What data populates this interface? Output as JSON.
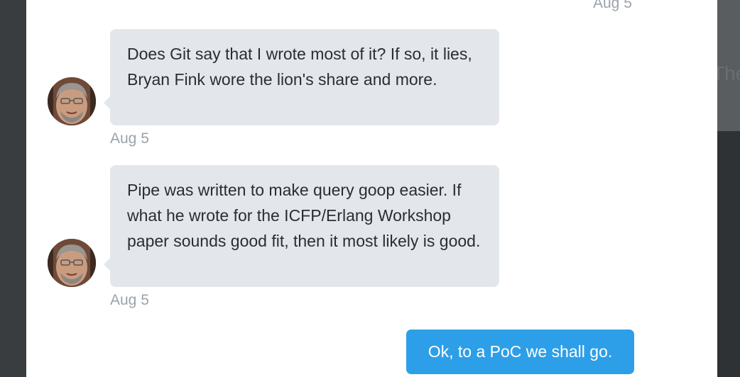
{
  "background": {
    "peek_text": "The"
  },
  "messages": [
    {
      "type": "timestamp",
      "text": "Aug 5"
    },
    {
      "type": "received",
      "avatar": "user-avatar",
      "text": "Does Git say that I wrote most of it? If so, it lies, Bryan Fink wore the lion's share and more.",
      "timestamp": "Aug 5"
    },
    {
      "type": "received",
      "avatar": "user-avatar",
      "text": "Pipe was written to make query goop easier. If what he wrote for the ICFP/Erlang Workshop paper sounds good fit, then it most likely is good.",
      "timestamp": "Aug 5"
    },
    {
      "type": "sent",
      "text": "Ok, to a PoC we shall go."
    }
  ],
  "colors": {
    "received_bubble": "#e3e7ec",
    "sent_bubble": "#2d9fe8",
    "timestamp": "#9aa3ad",
    "backdrop": "#3a3d40"
  }
}
